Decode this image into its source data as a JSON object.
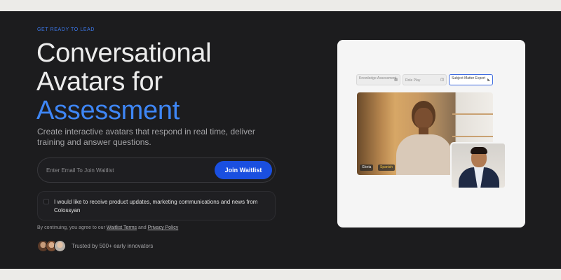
{
  "hero": {
    "eyebrow": "GET READY TO LEAD",
    "title_line1": "Conversational",
    "title_line2": "Avatars for",
    "title_accent": "Assessment",
    "subtitle": "Create interactive avatars that respond in real time, deliver training and answer questions."
  },
  "form": {
    "email_placeholder": "Enter Email To Join Waitlist",
    "join_label": "Join Waitlist",
    "consent_text": "I would like to receive product updates, marketing communications and news from Colossyan",
    "legal_prefix": "By continuing, you agree to our",
    "legal_terms": "Waitlist Terms",
    "legal_and": "and",
    "legal_privacy": "Privacy Policy"
  },
  "social_proof": {
    "trusted_text": "Trusted by 500+ early innovators"
  },
  "preview": {
    "tabs": [
      {
        "label": "Knowledge Assessment",
        "icon": "document-icon"
      },
      {
        "label": "Role Play",
        "icon": "users-icon"
      },
      {
        "label": "Subject Matter Expert",
        "icon": "cursor-icon"
      }
    ],
    "video_tags": [
      "Gloria",
      "Spanish"
    ]
  },
  "colors": {
    "background": "#1c1c1e",
    "accent": "#3e86f5",
    "button": "#1a4fe0",
    "card": "#f5f5f5"
  }
}
